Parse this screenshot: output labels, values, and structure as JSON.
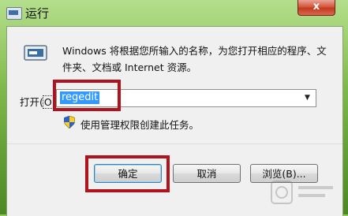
{
  "window": {
    "title": "运行",
    "close_label": "x"
  },
  "dialog": {
    "description": "Windows 将根据您所输入的名称，为您打开相应的程序、文件夹、文档或 Internet 资源。",
    "open_label": "打开(O):",
    "open_label_prefix": "打开(",
    "open_label_accel": "O",
    "open_label_suffix": "):",
    "input_value": "regedit",
    "admin_note": "使用管理权限创建此任务。"
  },
  "buttons": {
    "ok": "确定",
    "cancel": "取消",
    "browse": "浏览(B)..."
  },
  "colors": {
    "highlight": "#b0121e",
    "selection": "#3399ff"
  },
  "icons": [
    "run-icon",
    "shield-icon",
    "close-icon",
    "dropdown-arrow-icon"
  ]
}
